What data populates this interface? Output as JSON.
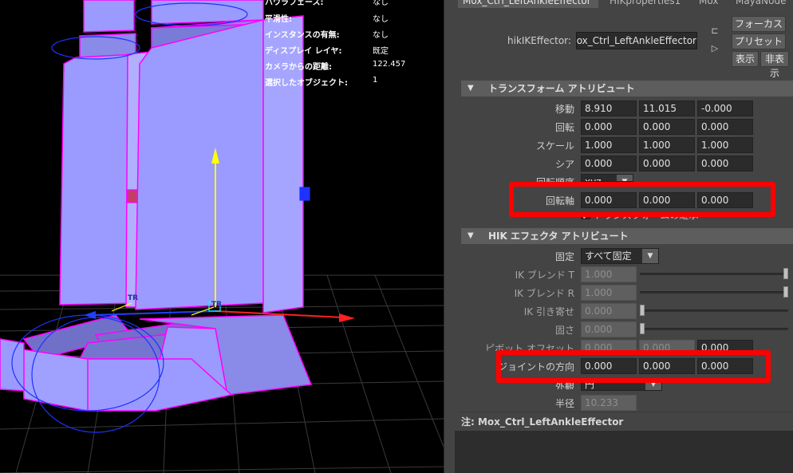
{
  "hud": [
    {
      "label": "ハウラフェース:",
      "value": "なし"
    },
    {
      "label": "平滑性:",
      "value": "なし"
    },
    {
      "label": "インスタンスの有無:",
      "value": "なし"
    },
    {
      "label": "ディスプレイ レイヤ:",
      "value": "既定"
    },
    {
      "label": "カメラからの距離:",
      "value": "122.457"
    },
    {
      "label": "選択したオブジェクト:",
      "value": "1"
    }
  ],
  "viewport": {
    "manip_labels": [
      "TR",
      "TR"
    ]
  },
  "tabs": [
    "Mox_Ctrl_LeftAnkleEffector",
    "HIKproperties1",
    "Mox",
    "MayaNode"
  ],
  "node": {
    "label": "hikIKEffector:",
    "value": "Mox_Ctrl_LeftAnkleEffector"
  },
  "buttons": {
    "focus": "フォーカス",
    "preset": "プリセット",
    "show": "表示",
    "hide": "非表示"
  },
  "transform": {
    "title": "トランスフォーム アトリビュート",
    "translate": {
      "label": "移動",
      "values": [
        "8.910",
        "11.015",
        "-0.000"
      ]
    },
    "rotate": {
      "label": "回転",
      "values": [
        "0.000",
        "0.000",
        "0.000"
      ]
    },
    "scale": {
      "label": "スケール",
      "values": [
        "1.000",
        "1.000",
        "1.000"
      ]
    },
    "shear": {
      "label": "シア",
      "values": [
        "0.000",
        "0.000",
        "0.000"
      ]
    },
    "rotate_order": {
      "label": "回転順序",
      "value": "xyz"
    },
    "rotate_axis": {
      "label": "回転軸",
      "values": [
        "0.000",
        "0.000",
        "0.000"
      ]
    },
    "inherit": {
      "label": "トランスフォームの継承",
      "checked": true
    }
  },
  "hik": {
    "title": "HIK エフェクタ アトリビュート",
    "pinning": {
      "label": "固定",
      "value": "すべて固定"
    },
    "ik_blend_t": {
      "label": "IK ブレンド T",
      "value": "1.000",
      "level": 1.0
    },
    "ik_blend_r": {
      "label": "IK ブレンド R",
      "value": "1.000",
      "level": 1.0
    },
    "ik_pull": {
      "label": "IK 引き寄せ",
      "value": "0.000",
      "level": 0.0
    },
    "stiffness": {
      "label": "固さ",
      "value": "0.000",
      "level": 0.0
    },
    "pivot_offset": {
      "label": "ピボット オフセット",
      "values": [
        "0.000",
        "0.000",
        "0.000"
      ]
    },
    "joint_orient": {
      "label": "ジョイントの方向",
      "values": [
        "0.000",
        "0.000",
        "0.000"
      ]
    },
    "look": {
      "label": "外観",
      "value": "円"
    },
    "radius": {
      "label": "半径",
      "value": "10.233"
    }
  },
  "notes": {
    "label": "注: Mox_Ctrl_LeftAnkleEffector"
  },
  "colors": {
    "mesh_fill": "#9b9bff",
    "mesh_edge": "#ff00ff",
    "highlight": "#ff0000",
    "panel_bg": "#444444"
  }
}
